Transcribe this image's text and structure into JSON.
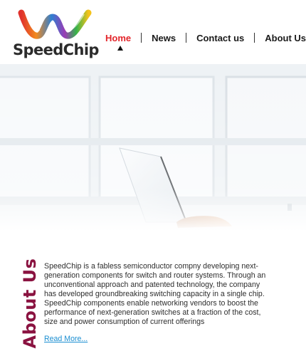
{
  "brand": {
    "name": "SpeedChip",
    "logo_colors": [
      "#e0312c",
      "#f28a1e",
      "#2f7fd1",
      "#35b34a",
      "#9a3bb5",
      "#f4c21a"
    ]
  },
  "nav": {
    "items": [
      {
        "label": "Home",
        "active": true
      },
      {
        "label": "News",
        "active": false
      },
      {
        "label": "Contact us",
        "active": false
      },
      {
        "label": "About Us",
        "active": false
      }
    ],
    "active_color": "#e3252a",
    "indicator_icon": "triangle-up-icon"
  },
  "about": {
    "heading": "About Us",
    "heading_color": "#8a1240",
    "paragraph": "SpeedChip is a fabless semiconductor compny developing next-generation components for switch and router systems. Through an unconventional approach and patented technology, the company has developed groundbreaking switching capacity in a single chip. SpeedChip components enable networking vendors to boost the performance of next-generation switches at a fraction of the cost, size and power consumption of current offerings",
    "read_more": "Read More...",
    "link_color": "#1a8ed1"
  }
}
